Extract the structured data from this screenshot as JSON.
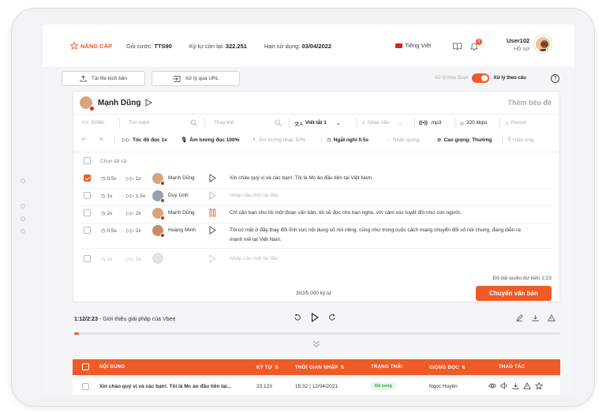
{
  "topbar": {
    "upgrade_label": "NÂNG CẤP",
    "plan_label": "Gói cước:",
    "plan_value": "TTS90",
    "chars_label": "Ký tự còn lại:",
    "chars_value": "322.251",
    "expiry_label": "Hạn sử dụng:",
    "expiry_value": "03/04/2022",
    "language": "Tiếng Việt",
    "notification_count": "2",
    "user_name": "User102",
    "user_sub": "Hồ sơ"
  },
  "actions": {
    "upload_label": "Tải file kịch bản",
    "url_label": "Xử lý qua URL",
    "mode_off_label": "Xử lý theo đoạn",
    "mode_on_label": "Xử lý theo câu",
    "help": "?"
  },
  "editor": {
    "voice_name": "Mạnh Dũng",
    "add_title": "Thêm tiêu đề",
    "toolbar1": {
      "ssml": "SSML",
      "search_placeholder": "Tìm kiếm",
      "replace_placeholder": "Thay thế",
      "abbr": "Viết tắt 1",
      "music": "Nhạc nền",
      "format": ".mp3",
      "bitrate": "320 kbps",
      "preset": "Preset"
    },
    "toolbar2": {
      "speed": "Tốc độ đọc 1x",
      "volume": "Âm lượng đọc 100%",
      "music_volume": "Âm lượng nhạc 50%",
      "pause": "Ngắt nghỉ 0.5s",
      "mix_voice": "Nhấn giọng",
      "pitch": "Cao giọng: Thường",
      "effects": "Hiệu ứng"
    },
    "select_all": "Chọn tất cả",
    "rows": [
      {
        "pause": "0.5s",
        "speed": "1x",
        "voice": "Mạnh Dũng",
        "text": "Xin chào quý vị và các bạn!. Tôi là Mc ảo đầu tiên tại Việt Nam.",
        "checked": true,
        "muted": false
      },
      {
        "pause": "1s",
        "speed": "1.5x",
        "voice": "Duy Linh",
        "text": "Nhập câu mới tại đây",
        "checked": false,
        "muted": true
      },
      {
        "pause": "2s",
        "speed": "2x",
        "voice": "Mạnh Dũng",
        "text": "Chỉ cần bạn cho tôi một đoạn văn bản, tôi sẽ đọc cho bạn nghe, với cảm xúc tuyệt đối như con người.",
        "checked": false,
        "muted": false
      },
      {
        "pause": "0.5s",
        "speed": "2x",
        "voice": "Hoàng Minh",
        "text_line1": "Tôi có mặt ở đây thay đổi lĩnh vực nội dung số nói riêng, cũng như trong cuộc cách mạng chuyển đổi số nói chung, đang diễn ra",
        "text_line2": "mạnh mẽ tại Việt Nam.",
        "checked": false,
        "muted": false
      },
      {
        "pause": "1s",
        "speed": "1x",
        "voice": "",
        "text": "Nhập câu mới tại đây",
        "checked": false,
        "muted": true
      }
    ],
    "duration": "Độ dài audio dự kiến 2:23",
    "char_counter": "302/5.000 ký tự",
    "convert_label": "Chuyển văn bản"
  },
  "player": {
    "time": "1:12/2:23",
    "title": " - Giới thiệu giải pháp của Vbee",
    "progress": 0.01
  },
  "table": {
    "headers": [
      "NỘI DUNG",
      "KÝ TỰ",
      "THỜI GIAN NHẬP",
      "TRẠNG THÁI",
      "GIỌNG ĐỌC",
      "THAO TÁC"
    ],
    "rows": [
      {
        "content": "Xin chào quý vị và các bạn!. Tôi là Mc ảo đầu tiên tại...",
        "chars": "23.123",
        "time": "15:32 | 12/04/2021",
        "status": "Đã xong",
        "voice": "Ngọc Huyền"
      }
    ]
  },
  "colors": {
    "accent": "#f05a28",
    "success": "#27a844"
  }
}
